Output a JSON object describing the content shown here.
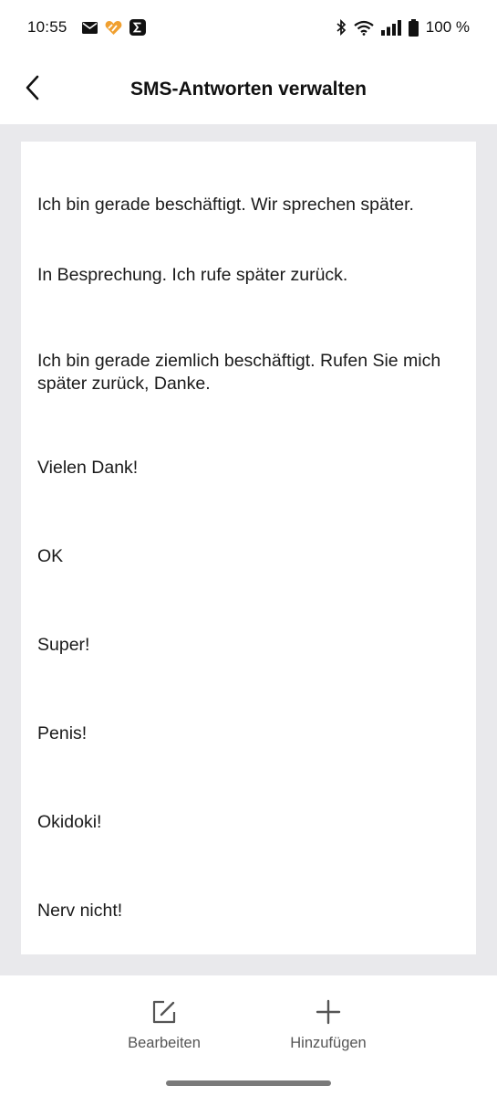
{
  "status_bar": {
    "time": "10:55",
    "battery_text": "100 %",
    "icons_left": [
      "mail-icon",
      "app-heart-icon",
      "sigma-app-icon"
    ],
    "icons_right": [
      "bluetooth-icon",
      "wifi-icon",
      "signal-icon",
      "battery-icon"
    ]
  },
  "header": {
    "title": "SMS-Antworten verwalten",
    "back_icon": "chevron-left-icon"
  },
  "replies": [
    "Ich bin gerade beschäftigt. Wir sprechen später.",
    "In Besprechung. Ich rufe später zurück.",
    "Ich bin gerade ziemlich beschäftigt. Rufen Sie mich später zurück, Danke.",
    "Vielen Dank!",
    "OK",
    "Super!",
    "Penis!",
    "Okidoki!",
    "Nerv nicht!"
  ],
  "bottom_bar": {
    "edit_label": "Bearbeiten",
    "edit_icon": "edit-icon",
    "add_label": "Hinzufügen",
    "add_icon": "plus-icon"
  },
  "colors": {
    "background_gray": "#e9e9ec",
    "text": "#1a1a1a",
    "secondary_text": "#555555",
    "accent_orange": "#f0a030"
  }
}
